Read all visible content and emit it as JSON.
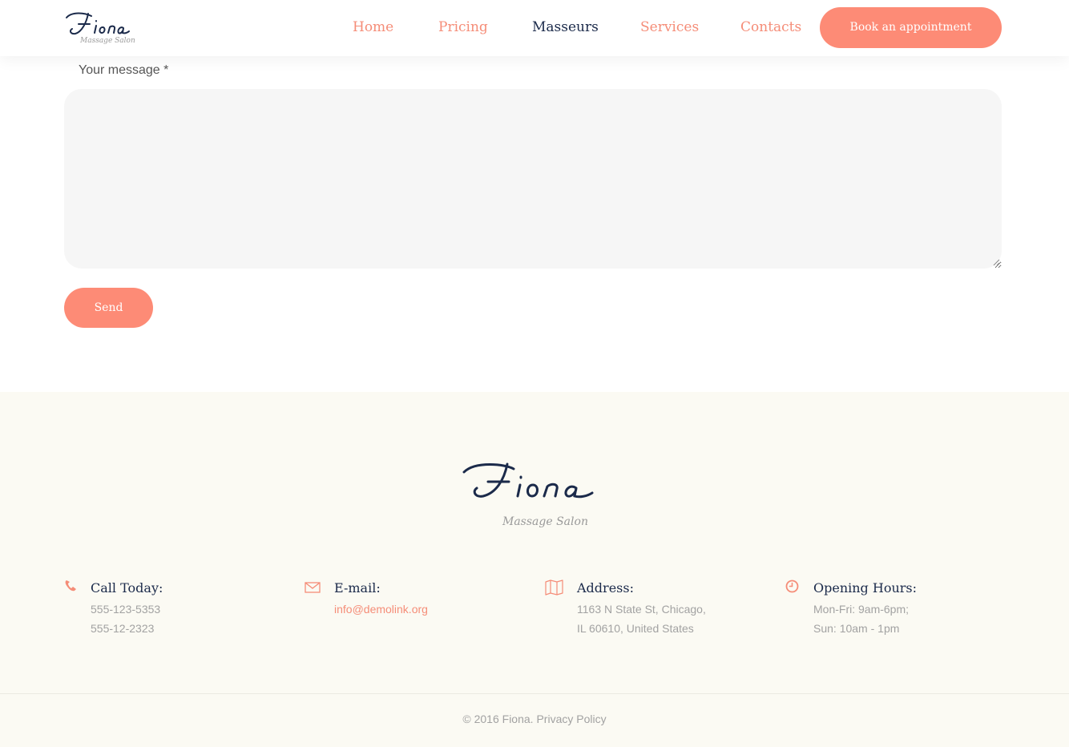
{
  "header": {
    "logo": {
      "script": "Fiona",
      "tagline": "Massage Salon"
    },
    "nav": [
      {
        "label": "Home",
        "active": false
      },
      {
        "label": "Pricing",
        "active": false
      },
      {
        "label": "Masseurs",
        "active": true
      },
      {
        "label": "Services",
        "active": false
      },
      {
        "label": "Contacts",
        "active": false
      }
    ],
    "cta": "Book an appointment"
  },
  "form": {
    "message_label": "Your message *",
    "message_value": "",
    "send_label": "Send"
  },
  "footer": {
    "logo": {
      "script": "Fiona",
      "tagline": "Massage Salon"
    },
    "columns": [
      {
        "icon": "phone-icon",
        "title": "Call Today:",
        "lines": [
          "555-123-5353",
          "555-12-2323"
        ]
      },
      {
        "icon": "envelope-icon",
        "title": "E-mail:",
        "lines": [
          "info@demolink.org"
        ]
      },
      {
        "icon": "map-icon",
        "title": "Address:",
        "lines": [
          "1163 N State St, Chicago,",
          "IL 60610, United States"
        ]
      },
      {
        "icon": "clock-icon",
        "title": "Opening Hours:",
        "lines": [
          "Mon-Fri: 9am-6pm;",
          "Sun: 10am - 1pm"
        ]
      }
    ],
    "copyright": "© 2016 Fiona.",
    "privacy": "Privacy Policy"
  },
  "colors": {
    "accent": "#fd8b76",
    "navy": "#1b2a4a",
    "footer_bg": "#fbfaf3"
  }
}
